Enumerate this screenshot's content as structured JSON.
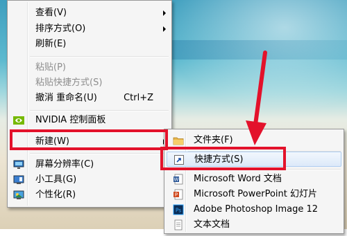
{
  "context_menu": {
    "items": [
      {
        "label": "查看(V)",
        "submenu": true
      },
      {
        "label": "排序方式(O)",
        "submenu": true
      },
      {
        "label": "刷新(E)"
      },
      {
        "label": "粘贴(P)",
        "disabled": true
      },
      {
        "label": "粘贴快捷方式(S)",
        "disabled": true
      },
      {
        "label": "撤消 重命名(U)",
        "shortcut": "Ctrl+Z"
      },
      {
        "label": "NVIDIA 控制面板",
        "icon": "nvidia-icon"
      },
      {
        "label": "新建(W)",
        "submenu": true,
        "highlighted": true
      },
      {
        "label": "屏幕分辨率(C)",
        "icon": "display-icon"
      },
      {
        "label": "小工具(G)",
        "icon": "gadgets-icon"
      },
      {
        "label": "个性化(R)",
        "icon": "personalize-icon"
      }
    ]
  },
  "new_submenu": {
    "items": [
      {
        "label": "文件夹(F)",
        "icon": "folder-icon"
      },
      {
        "label": "快捷方式(S)",
        "icon": "shortcut-icon",
        "highlighted": true
      },
      {
        "label": "Microsoft Word 文档",
        "icon": "word-doc-icon"
      },
      {
        "label": "Microsoft PowerPoint 幻灯片",
        "icon": "powerpoint-icon"
      },
      {
        "label": "Adobe Photoshop Image 12",
        "icon": "photoshop-icon"
      },
      {
        "label": "文本文档",
        "icon": "text-doc-icon"
      }
    ]
  },
  "colors": {
    "highlight_red": "#e3122b",
    "menu_bg": "#f5f5f5"
  }
}
